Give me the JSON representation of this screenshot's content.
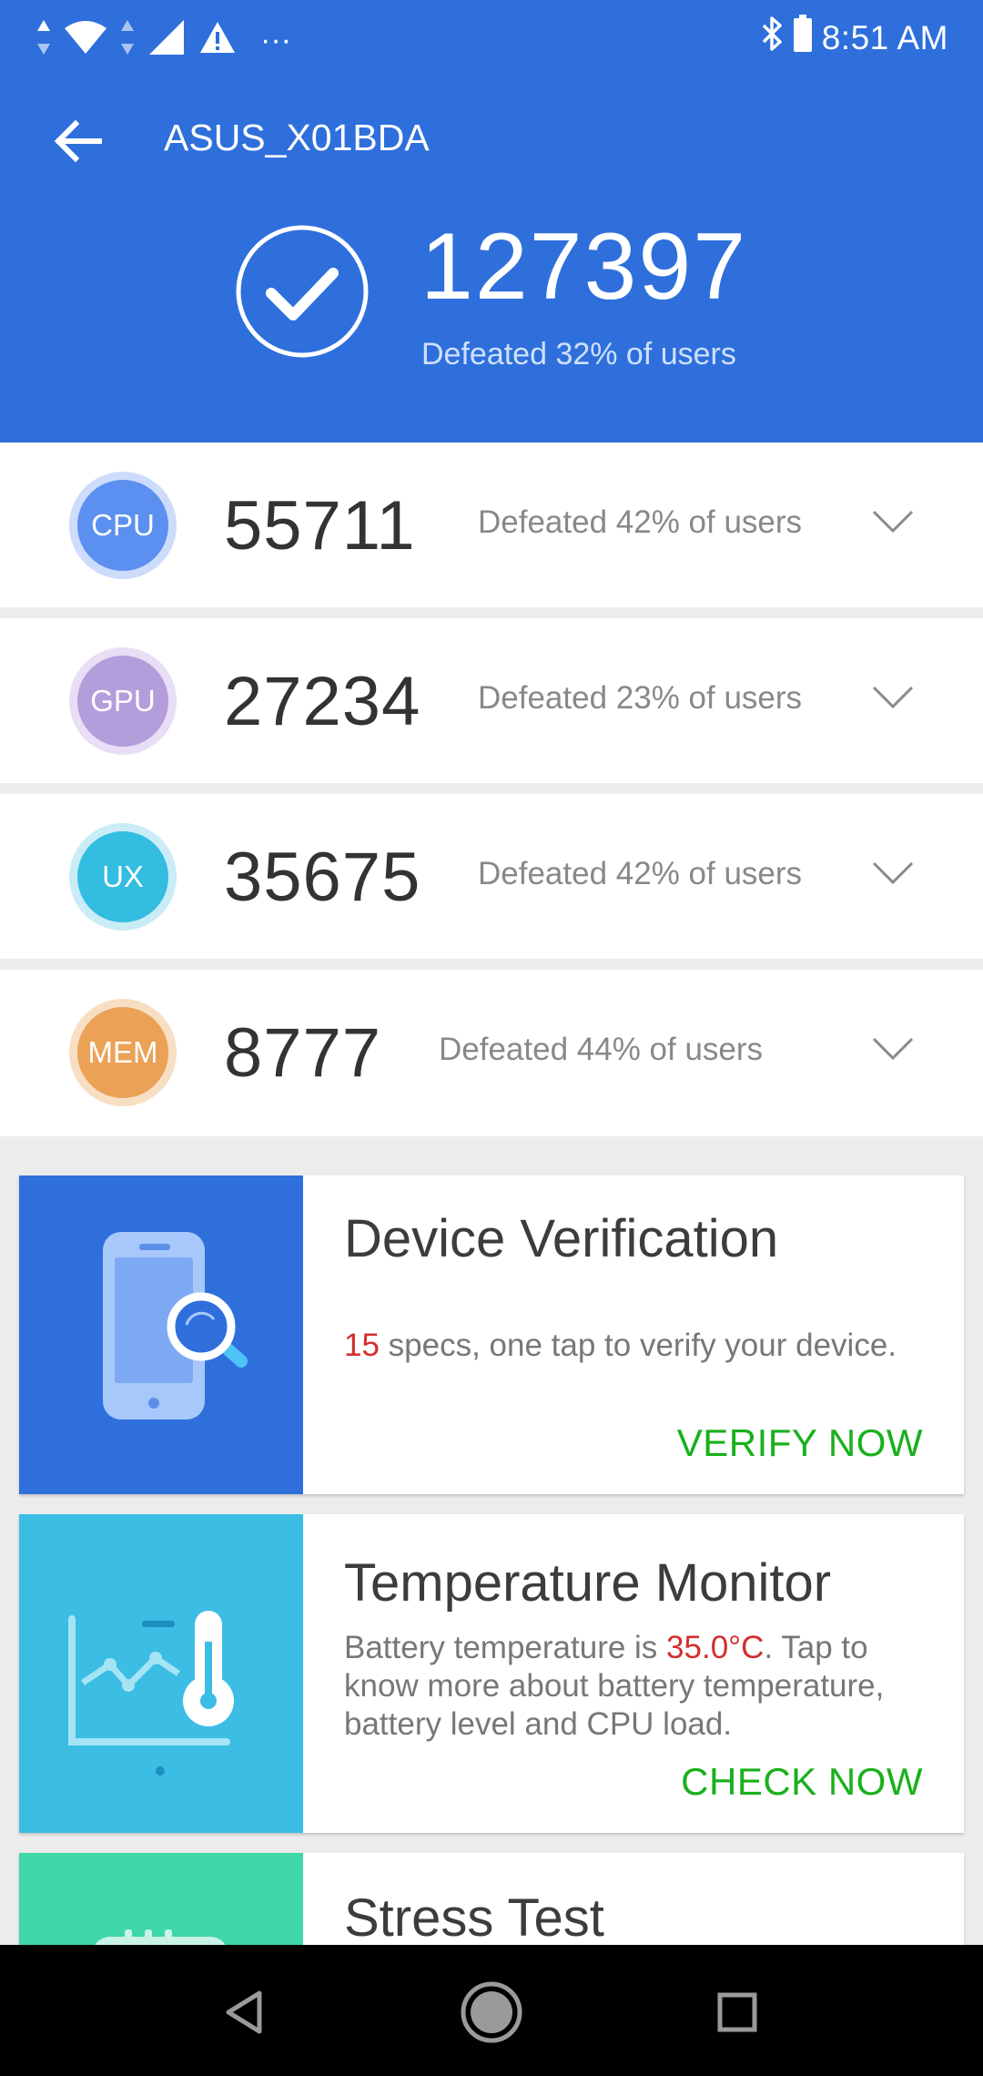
{
  "status_bar": {
    "time": "8:51 AM",
    "more": "···"
  },
  "appbar": {
    "title": "ASUS_X01BDA"
  },
  "summary": {
    "total_score": "127397",
    "defeated_text": "Defeated 32% of users"
  },
  "scores": [
    {
      "badge": "CPU",
      "score": "55711",
      "defeated": "Defeated 42% of users",
      "color": "#5b8ff0",
      "ring": "#cddcfb"
    },
    {
      "badge": "GPU",
      "score": "27234",
      "defeated": "Defeated 23% of users",
      "color": "#b39ddb",
      "ring": "#e8def5"
    },
    {
      "badge": "UX",
      "score": "35675",
      "defeated": "Defeated 42% of users",
      "color": "#33bde0",
      "ring": "#c9ecf6"
    },
    {
      "badge": "MEM",
      "score": "8777",
      "defeated": "Defeated 44% of users",
      "color": "#eba156",
      "ring": "#f8dfc4"
    }
  ],
  "cards": {
    "device_verification": {
      "title": "Device Verification",
      "count": "15",
      "desc_rest": " specs, one tap to verify your device.",
      "cta": "VERIFY NOW",
      "art_color": "#2f6fdc"
    },
    "temperature_monitor": {
      "title": "Temperature Monitor",
      "desc_pre": "Battery temperature is ",
      "temp": "35.0°C",
      "desc_post": ". Tap to know more about battery temperature, battery level and CPU load.",
      "cta": "CHECK NOW",
      "art_color": "#3bbde4"
    },
    "stress_test": {
      "title": "Stress Test",
      "art_color": "#3fd6a8"
    }
  },
  "colors": {
    "header_bg": "#2e6fdc",
    "cta_green": "#19b01c",
    "highlight_red": "#d32f2f"
  }
}
